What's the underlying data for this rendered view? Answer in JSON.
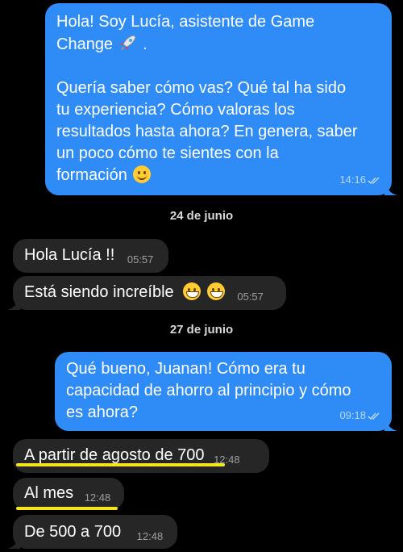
{
  "messages": [
    {
      "direction": "outgoing",
      "line1": "Hola! Soy Lucía, asistente de Game",
      "line2": "Change",
      "line3": "Quería saber cómo vas? Qué tal ha sido",
      "line4": "tu experiencia? Cómo valoras los",
      "line5": "resultados hasta ahora? En genera, saber",
      "line6": "un poco cómo te sientes con la",
      "line7": "formación",
      "time": "14:16"
    },
    {
      "direction": "date",
      "text": "24 de junio"
    },
    {
      "direction": "incoming",
      "text": "Hola Lucía !!",
      "time": "05:57"
    },
    {
      "direction": "incoming",
      "text": "Está siendo increíble",
      "time": "05:57"
    },
    {
      "direction": "date",
      "text": "27 de junio"
    },
    {
      "direction": "outgoing",
      "line1": "Qué bueno, Juanan! Cómo era tu",
      "line2": "capacidad de ahorro al principio y cómo",
      "line3": "es ahora?",
      "time": "09:18"
    },
    {
      "direction": "incoming",
      "text": "A partir de agosto de 700",
      "time": "12:48"
    },
    {
      "direction": "incoming",
      "text": "Al mes",
      "time": "12:48"
    },
    {
      "direction": "incoming",
      "text": "De 500 a 700",
      "time": "12:48"
    }
  ],
  "icons": {
    "rocket": "rocket-emoji",
    "smile": "smiling-face-emoji",
    "grin": "grinning-face-emoji",
    "read": "double-check-read-icon"
  },
  "colors": {
    "outgoing_bubble": "#2f8cf6",
    "incoming_bubble": "#262626",
    "highlight_underline": "#f3e51e",
    "background": "#000000"
  }
}
